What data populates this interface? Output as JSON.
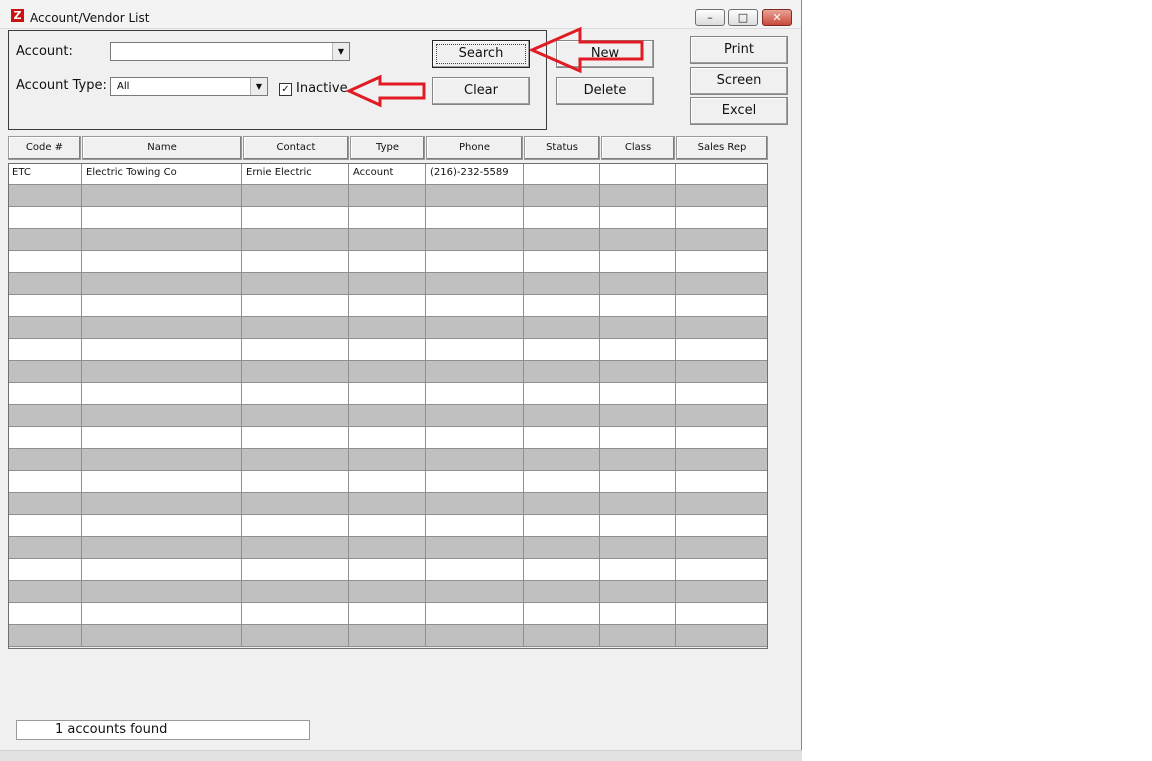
{
  "window": {
    "title": "Account/Vendor List",
    "app_icon_letter": "Z",
    "controls": {
      "minimize": "–",
      "maximize": "□",
      "close": "✕"
    }
  },
  "filters": {
    "account_label": "Account:",
    "account_value": "",
    "account_type_label": "Account Type:",
    "account_type_value": "All",
    "inactive_label": "Inactive",
    "inactive_checked": true,
    "check_glyph": "✓",
    "dropdown_glyph": "▼"
  },
  "buttons": {
    "search": "Search",
    "clear": "Clear",
    "new": "New",
    "delete": "Delete",
    "print": "Print",
    "screen": "Screen",
    "excel": "Excel"
  },
  "annotations": {
    "arrow_color": "#e01b24"
  },
  "table": {
    "columns": [
      "Code #",
      "Name",
      "Contact",
      "Type",
      "Phone",
      "Status",
      "Class",
      "Sales Rep"
    ],
    "rows": [
      [
        "ETC",
        "Electric Towing Co",
        "Ernie Electric",
        "Account",
        "(216)-232-5589",
        "",
        "",
        ""
      ]
    ]
  },
  "status": {
    "text": "1 accounts found"
  }
}
